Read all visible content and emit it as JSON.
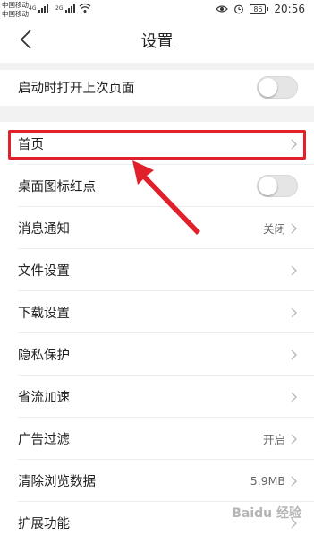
{
  "status": {
    "carrier1": "中国移动",
    "carrier2": "中国移动",
    "net1": "4G",
    "net2": "2G",
    "battery": "86",
    "time": "20:56"
  },
  "header": {
    "title": "设置"
  },
  "rows": [
    {
      "label": "启动时打开上次页面"
    },
    {
      "label": "首页"
    },
    {
      "label": "桌面图标红点"
    },
    {
      "label": "消息通知",
      "value": "关闭"
    },
    {
      "label": "文件设置"
    },
    {
      "label": "下载设置"
    },
    {
      "label": "隐私保护"
    },
    {
      "label": "省流加速"
    },
    {
      "label": "广告过滤",
      "value": "开启"
    },
    {
      "label": "清除浏览数据",
      "value": "5.9MB"
    },
    {
      "label": "扩展功能"
    }
  ],
  "watermark": "Baidu 经验"
}
